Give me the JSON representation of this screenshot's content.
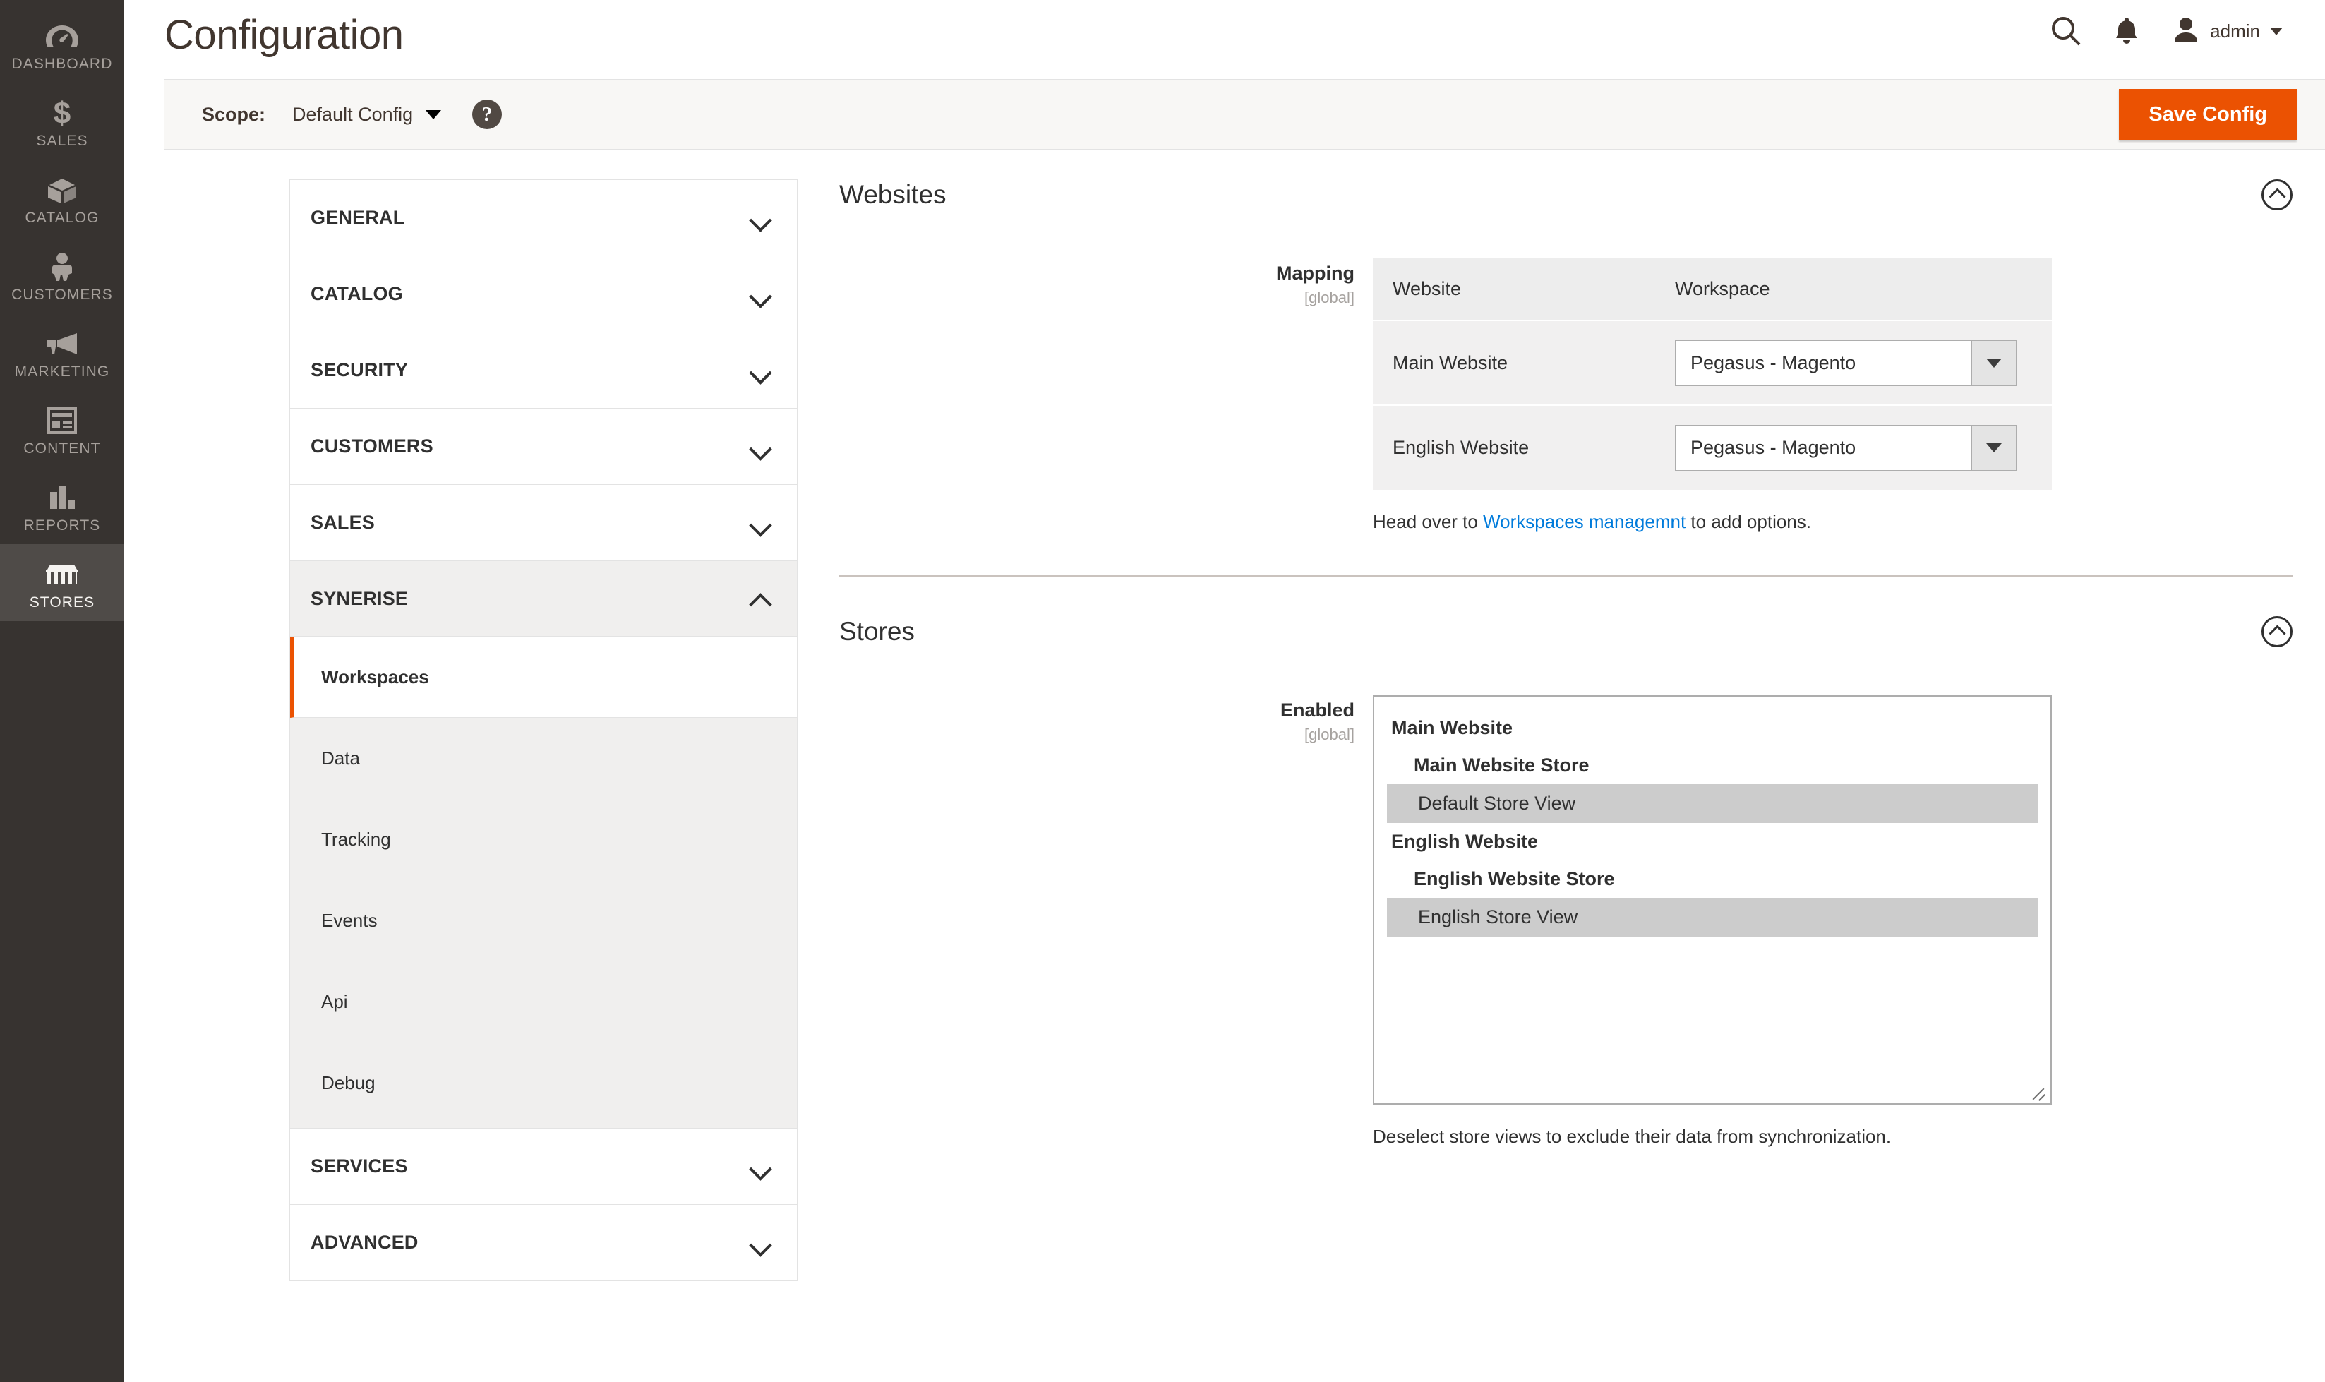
{
  "rail": {
    "items": [
      {
        "label": "DASHBOARD",
        "icon": "dashboard-icon",
        "active": false
      },
      {
        "label": "SALES",
        "icon": "dollar-icon",
        "active": false
      },
      {
        "label": "CATALOG",
        "icon": "box-icon",
        "active": false
      },
      {
        "label": "CUSTOMERS",
        "icon": "person-icon",
        "active": false
      },
      {
        "label": "MARKETING",
        "icon": "megaphone-icon",
        "active": false
      },
      {
        "label": "CONTENT",
        "icon": "layout-icon",
        "active": false
      },
      {
        "label": "REPORTS",
        "icon": "bar-chart-icon",
        "active": false
      },
      {
        "label": "STORES",
        "icon": "storefront-icon",
        "active": true
      }
    ]
  },
  "header": {
    "title": "Configuration",
    "search_icon": "search-icon",
    "notifications_icon": "bell-icon",
    "avatar_icon": "user-avatar-icon",
    "admin_name": "admin",
    "caret_icon": "caret-down-icon"
  },
  "scope_bar": {
    "label": "Scope:",
    "value": "Default Config",
    "caret_icon": "caret-down-icon",
    "help_icon": "question-mark-icon",
    "help_glyph": "?",
    "save_label": "Save Config",
    "save_color": "#eb5202"
  },
  "config_nav": {
    "sections": [
      {
        "title": "GENERAL",
        "expanded": false
      },
      {
        "title": "CATALOG",
        "expanded": false
      },
      {
        "title": "SECURITY",
        "expanded": false
      },
      {
        "title": "CUSTOMERS",
        "expanded": false
      },
      {
        "title": "SALES",
        "expanded": false
      },
      {
        "title": "SYNERISE",
        "expanded": true
      },
      {
        "title": "SERVICES",
        "expanded": false
      },
      {
        "title": "ADVANCED",
        "expanded": false
      }
    ],
    "synerise_items": [
      {
        "label": "Workspaces",
        "active": true
      },
      {
        "label": "Data",
        "active": false
      },
      {
        "label": "Tracking",
        "active": false
      },
      {
        "label": "Events",
        "active": false
      },
      {
        "label": "Api",
        "active": false
      },
      {
        "label": "Debug",
        "active": false
      }
    ],
    "active_accent": "#eb5202"
  },
  "websites_section": {
    "title": "Websites",
    "collapse_icon": "chevron-up-circle-icon",
    "field": {
      "label": "Mapping",
      "scope": "[global]"
    },
    "table": {
      "headers": [
        "Website",
        "Workspace"
      ],
      "rows": [
        {
          "website": "Main Website",
          "workspace": "Pegasus - Magento"
        },
        {
          "website": "English Website",
          "workspace": "Pegasus - Magento"
        }
      ]
    },
    "note_prefix": "Head over to ",
    "note_link": "Workspaces managemnt",
    "note_suffix": " to add options.",
    "link_color": "#007bdb"
  },
  "stores_section": {
    "title": "Stores",
    "collapse_icon": "chevron-up-circle-icon",
    "field": {
      "label": "Enabled",
      "scope": "[global]"
    },
    "tree": [
      {
        "website": "Main Website",
        "group": "Main Website Store",
        "view": "Default Store View",
        "selected": true
      },
      {
        "website": "English Website",
        "group": "English Website Store",
        "view": "English Store View",
        "selected": true
      }
    ],
    "note": "Deselect store views to exclude their data from synchronization."
  }
}
